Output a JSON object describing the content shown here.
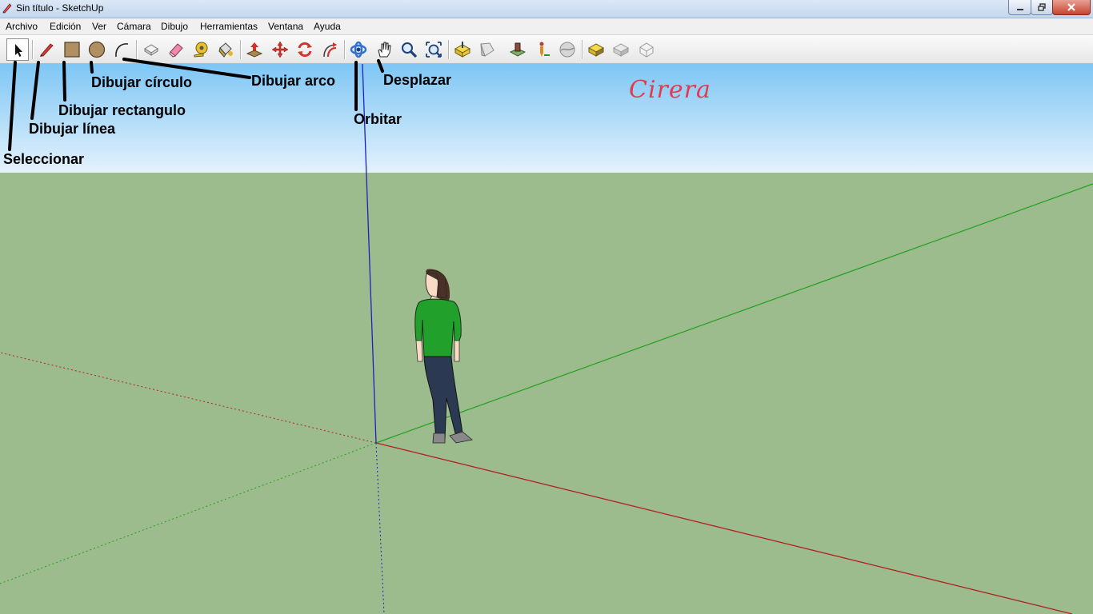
{
  "window": {
    "title": "Sin título - SketchUp"
  },
  "menu": [
    "Archivo",
    "Edición",
    "Ver",
    "Cámara",
    "Dibujo",
    "Herramientas",
    "Ventana",
    "Ayuda"
  ],
  "callouts": {
    "seleccionar": "Seleccionar",
    "dibujar_linea": "Dibujar línea",
    "dibujar_rectangulo": "Dibujar rectangulo",
    "dibujar_circulo": "Dibujar círculo",
    "dibujar_arco": "Dibujar arco",
    "orbitar": "Orbitar",
    "desplazar": "Desplazar"
  },
  "watermark": "Cirera",
  "colors": {
    "sky_top": "#7ec6f5",
    "sky_bottom": "#e4f2fc",
    "ground": "#9dbc8e",
    "axis_red": "#b22222",
    "axis_green": "#1fa01f",
    "axis_blue": "#2020c0",
    "watermark": "#e33a4f"
  }
}
